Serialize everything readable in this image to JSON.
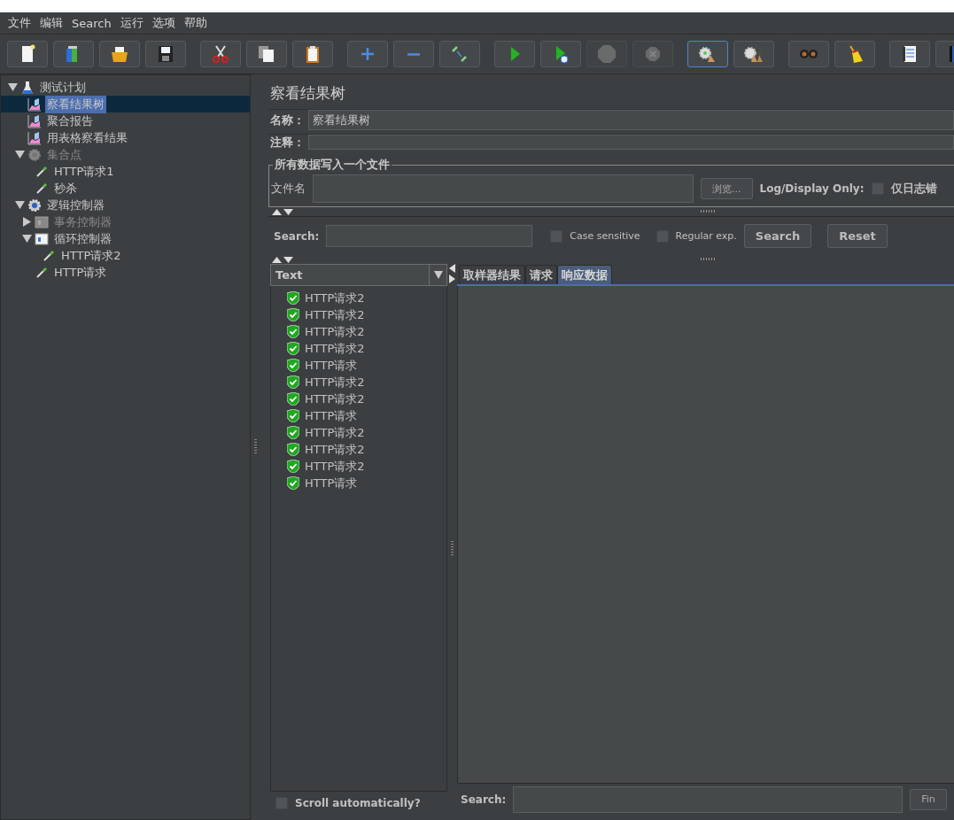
{
  "menu": [
    {
      "label": "文件"
    },
    {
      "label": "编辑"
    },
    {
      "label": "Search"
    },
    {
      "label": "运行"
    },
    {
      "label": "选项"
    },
    {
      "label": "帮助"
    }
  ],
  "toolbar": [
    {
      "buttons": [
        {
          "kind": "new",
          "disabled": false,
          "selected": false
        },
        {
          "kind": "templates",
          "disabled": false,
          "selected": false
        },
        {
          "kind": "open",
          "disabled": false,
          "selected": false
        },
        {
          "kind": "save",
          "disabled": false,
          "selected": false
        }
      ]
    },
    {
      "buttons": [
        {
          "kind": "cut",
          "disabled": false,
          "selected": false
        },
        {
          "kind": "copy",
          "disabled": false,
          "selected": false
        },
        {
          "kind": "paste",
          "disabled": false,
          "selected": false
        }
      ]
    },
    {
      "buttons": [
        {
          "kind": "expand",
          "disabled": false,
          "selected": false
        },
        {
          "kind": "collapse",
          "disabled": false,
          "selected": false
        },
        {
          "kind": "toggle",
          "disabled": false,
          "selected": false
        }
      ]
    },
    {
      "buttons": [
        {
          "kind": "start",
          "disabled": false,
          "selected": false
        },
        {
          "kind": "start_no_timers",
          "disabled": false,
          "selected": false
        },
        {
          "kind": "stop",
          "disabled": true,
          "selected": false
        },
        {
          "kind": "shutdown",
          "disabled": true,
          "selected": false
        }
      ]
    },
    {
      "buttons": [
        {
          "kind": "clear",
          "disabled": false,
          "selected": true
        },
        {
          "kind": "clear_all",
          "disabled": false,
          "selected": false
        }
      ]
    },
    {
      "buttons": [
        {
          "kind": "search",
          "disabled": false,
          "selected": false
        },
        {
          "kind": "reset_search",
          "disabled": false,
          "selected": false
        }
      ]
    },
    {
      "buttons": [
        {
          "kind": "function",
          "disabled": false,
          "selected": false
        },
        {
          "kind": "help",
          "disabled": false,
          "selected": false
        }
      ]
    }
  ],
  "tree": [
    {
      "label": "测试计划",
      "kind": "plan",
      "expanded": true,
      "selected": false,
      "disabled": false,
      "children": [
        {
          "label": "察看结果树",
          "kind": "listener",
          "selected": true,
          "disabled": false
        },
        {
          "label": "聚合报告",
          "kind": "listener",
          "selected": false,
          "disabled": false
        },
        {
          "label": "用表格察看结果",
          "kind": "listener",
          "selected": false,
          "disabled": false
        },
        {
          "label": "集合点",
          "kind": "group",
          "expanded": true,
          "selected": false,
          "disabled": true,
          "children": [
            {
              "label": "HTTP请求1",
              "kind": "sampler",
              "selected": false,
              "disabled": false
            },
            {
              "label": "秒杀",
              "kind": "sampler",
              "selected": false,
              "disabled": false
            }
          ]
        },
        {
          "label": "逻辑控制器",
          "kind": "group",
          "expanded": true,
          "selected": false,
          "disabled": false,
          "children": [
            {
              "label": "事务控制器",
              "kind": "controller",
              "expanded": false,
              "selected": false,
              "disabled": true
            },
            {
              "label": "循环控制器",
              "kind": "controller",
              "expanded": true,
              "selected": false,
              "disabled": false,
              "children": [
                {
                  "label": "HTTP请求2",
                  "kind": "sampler",
                  "selected": false,
                  "disabled": false
                }
              ]
            },
            {
              "label": "HTTP请求",
              "kind": "sampler",
              "selected": false,
              "disabled": false
            }
          ]
        }
      ]
    }
  ],
  "panel": {
    "title": "察看结果树",
    "name_label": "名称：",
    "name_value": "察看结果树",
    "comment_label": "注释：",
    "file_group": {
      "legend": "所有数据写入一个文件",
      "file_label": "文件名",
      "browse_button": "浏览...",
      "log_label": "Log/Display Only:",
      "errors_only": {
        "label": "仅日志错",
        "checked": false
      }
    },
    "search": {
      "label": "Search:",
      "case_sensitive": {
        "label": "Case sensitive",
        "checked": false
      },
      "regex": {
        "label": "Regular exp.",
        "checked": false
      },
      "search_button": "Search",
      "reset_button": "Reset"
    },
    "renderer": {
      "value": "Text"
    },
    "results": [
      {
        "label": "HTTP请求2",
        "success": true
      },
      {
        "label": "HTTP请求2",
        "success": true
      },
      {
        "label": "HTTP请求2",
        "success": true
      },
      {
        "label": "HTTP请求2",
        "success": true
      },
      {
        "label": "HTTP请求",
        "success": true
      },
      {
        "label": "HTTP请求2",
        "success": true
      },
      {
        "label": "HTTP请求2",
        "success": true
      },
      {
        "label": "HTTP请求",
        "success": true
      },
      {
        "label": "HTTP请求2",
        "success": true
      },
      {
        "label": "HTTP请求2",
        "success": true
      },
      {
        "label": "HTTP请求2",
        "success": true
      },
      {
        "label": "HTTP请求",
        "success": true
      }
    ],
    "scroll_auto": {
      "label": "Scroll automatically?",
      "checked": false
    },
    "tabs": [
      {
        "label": "取样器结果",
        "selected": false
      },
      {
        "label": "请求",
        "selected": false
      },
      {
        "label": "响应数据",
        "selected": true
      }
    ],
    "response_search": {
      "label": "Search:",
      "find_button": "Fin"
    }
  }
}
